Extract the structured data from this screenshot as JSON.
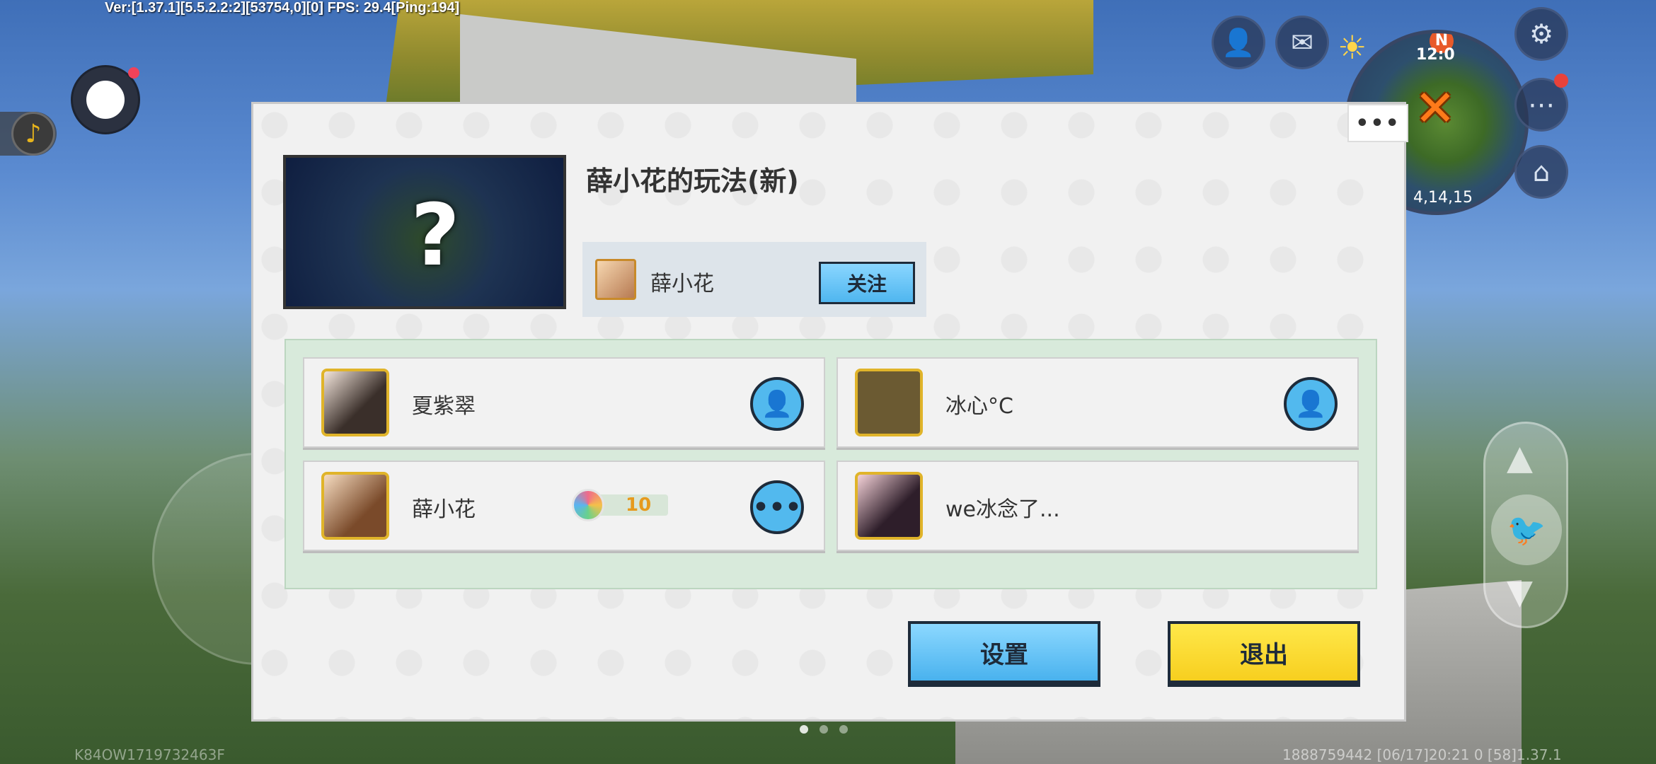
{
  "hud": {
    "version_text": "Ver:[1.37.1][5.5.2.2:2][53754,0][0] FPS: 29.4[Ping:194]",
    "minimap": {
      "compass": "N",
      "time": "12:0",
      "coords": "4,14,15"
    },
    "footer_left": "K84OW1719732463F",
    "footer_right": "1888759442   [06/17]20:21 0   [58]1.37.1"
  },
  "dialog": {
    "more_label": "•••",
    "close_label": "✕",
    "map_title": "薛小花的玩法(新)",
    "author": {
      "name": "薛小花",
      "follow_label": "关注"
    },
    "players": [
      {
        "name": "夏紫翠",
        "action": "add-friend"
      },
      {
        "name": "冰心°C",
        "action": "add-friend"
      },
      {
        "name": "薛小花",
        "level": "10",
        "action": "chat"
      },
      {
        "name": "we冰念了..."
      }
    ],
    "settings_label": "设置",
    "exit_label": "退出"
  },
  "icons": {
    "more_dots": "•••",
    "chat_dots": "•••"
  },
  "colors": {
    "accent_blue": "#52b9ee",
    "accent_yellow": "#f7cf1f",
    "panel_green": "#d8eadb"
  }
}
